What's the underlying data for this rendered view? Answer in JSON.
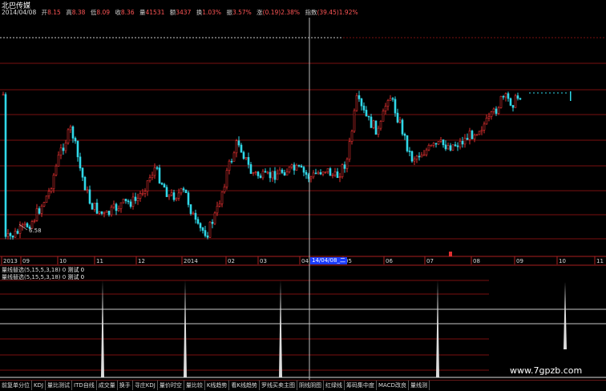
{
  "stock": {
    "name": "北巴传媒"
  },
  "quote": {
    "date": "2014/04/08",
    "fields": [
      {
        "k": "开",
        "v": "8.15"
      },
      {
        "k": "高",
        "v": "8.38"
      },
      {
        "k": "低",
        "v": "8.09"
      },
      {
        "k": "收",
        "v": "8.36"
      },
      {
        "k": "量",
        "v": "41531"
      },
      {
        "k": "额",
        "v": "3437"
      },
      {
        "k": "换",
        "v": "1.03%"
      },
      {
        "k": "振",
        "v": "3.57%"
      },
      {
        "k": "涨",
        "v": "(0.19)2.38%"
      },
      {
        "k": "指数",
        "v": "(39.45)1.92%"
      }
    ]
  },
  "colors": {
    "up": "#e03030",
    "down": "#30d8e8",
    "grid": "#7a1010",
    "indicator": "#dddddd",
    "axis": "#aa2020"
  },
  "chart": {
    "low_label": "6.58",
    "dates": [
      {
        "label": "2013"
      },
      {
        "label": "09"
      },
      {
        "label": "10"
      },
      {
        "label": "11"
      },
      {
        "label": "12"
      },
      {
        "label": "2014"
      },
      {
        "label": "02"
      },
      {
        "label": "03"
      },
      {
        "label": "04"
      },
      {
        "label": "05"
      },
      {
        "label": "06"
      },
      {
        "label": "07"
      },
      {
        "label": "08"
      },
      {
        "label": "09"
      },
      {
        "label": "10"
      },
      {
        "label": "11"
      }
    ],
    "cursor_date": "14/04/08_二"
  },
  "indicator": {
    "line1_label": "量线替选(5,15,5,3,18) 0",
    "line1_value": "测试 0",
    "line2_label": "量线替选(5,15,5,3,18) 0",
    "line2_value": "测试 0",
    "spikes": [
      1,
      1,
      1,
      1,
      1
    ]
  },
  "tabs": [
    "前复单分位",
    "KDJ",
    "量比测试",
    "ITD自线",
    "成交量",
    "换手",
    "寻庄KDJ",
    "量价时空",
    "量比较",
    "K线趋势",
    "看K线趋势",
    "罗线买卖主图",
    "阴线阴图",
    "红绿线",
    "筹码集中度",
    "MACD改良",
    "量线测"
  ],
  "watermark": "www.7gpzb.com"
}
